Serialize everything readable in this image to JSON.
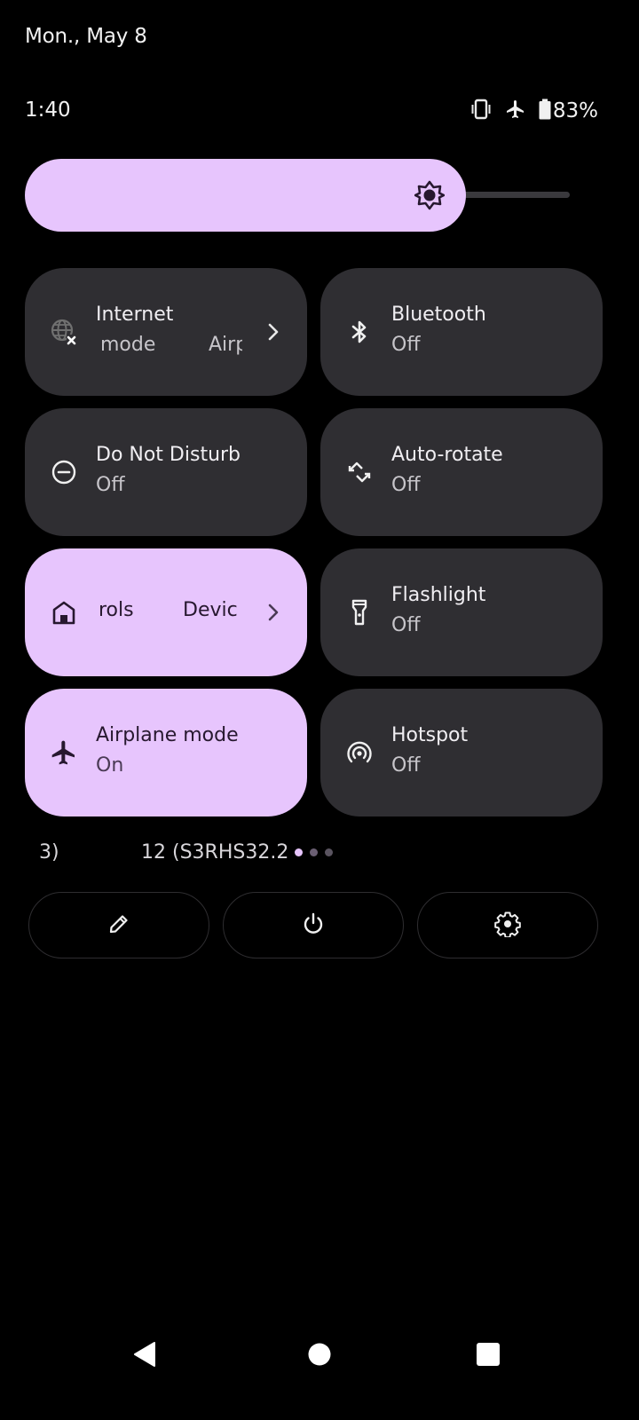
{
  "header": {
    "date": "Mon., May 8",
    "time": "1:40",
    "status_icons": [
      "vibrate-icon",
      "airplane-icon",
      "battery-icon"
    ],
    "battery_percent": "83%"
  },
  "brightness": {
    "level_fraction": 0.78,
    "icon": "brightness-icon"
  },
  "tiles": [
    {
      "name": "internet",
      "label": "Internet",
      "secondary_fragments": [
        "mode",
        "Airp"
      ],
      "state": "off",
      "has_chevron": true,
      "icon": "globe-x-icon"
    },
    {
      "name": "bluetooth",
      "label": "Bluetooth",
      "sub": "Off",
      "state": "off",
      "icon": "bluetooth-icon"
    },
    {
      "name": "do-not-disturb",
      "label": "Do Not Disturb",
      "sub": "Off",
      "state": "off",
      "icon": "do-not-disturb-icon"
    },
    {
      "name": "auto-rotate",
      "label": "Auto-rotate",
      "sub": "Off",
      "state": "off",
      "icon": "auto-rotate-icon"
    },
    {
      "name": "device-controls",
      "label_fragments": [
        "rols",
        "Devic"
      ],
      "state": "on",
      "has_chevron": true,
      "icon": "home-icon"
    },
    {
      "name": "flashlight",
      "label": "Flashlight",
      "sub": "Off",
      "state": "off",
      "icon": "flashlight-icon"
    },
    {
      "name": "airplane-mode",
      "label": "Airplane mode",
      "sub": "On",
      "state": "on",
      "icon": "airplane-icon"
    },
    {
      "name": "hotspot",
      "label": "Hotspot",
      "sub": "Off",
      "state": "off",
      "icon": "hotspot-icon"
    }
  ],
  "footer": {
    "build_fragments": [
      "3)",
      "12 (S3RHS32.2"
    ],
    "page_count": 3,
    "current_page": 1
  },
  "actions": [
    {
      "name": "edit",
      "icon": "pencil-icon"
    },
    {
      "name": "power",
      "icon": "power-icon"
    },
    {
      "name": "settings",
      "icon": "gear-icon"
    }
  ],
  "nav": [
    "back",
    "home",
    "recents"
  ],
  "colors": {
    "accent": "#e7c5fd",
    "tile_off": "#2f2e32",
    "background": "#000000",
    "on_accent_text": "#27182f"
  }
}
